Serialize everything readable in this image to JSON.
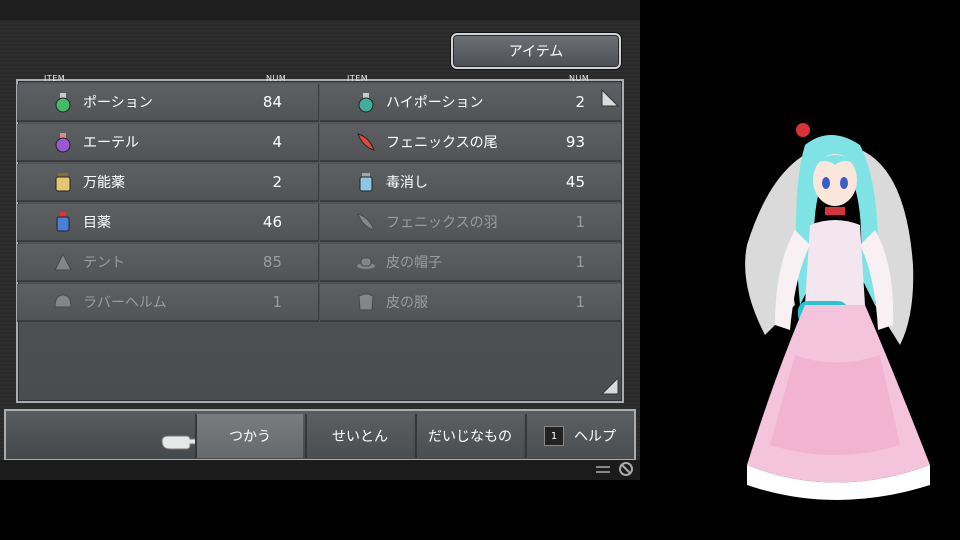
{
  "menu_title": "アイテム",
  "headers": {
    "item": "ITEM",
    "num": "NUM"
  },
  "items_left": [
    {
      "name": "ポーション",
      "num": "84",
      "icon": "potion-icon",
      "dim": false
    },
    {
      "name": "エーテル",
      "num": "4",
      "icon": "ether-icon",
      "dim": false
    },
    {
      "name": "万能薬",
      "num": "2",
      "icon": "elixir-jar-icon",
      "dim": false
    },
    {
      "name": "目薬",
      "num": "46",
      "icon": "eye-drops-icon",
      "dim": false
    },
    {
      "name": "テント",
      "num": "85",
      "icon": "tent-icon",
      "dim": true
    },
    {
      "name": "ラバーヘルム",
      "num": "1",
      "icon": "helm-icon",
      "dim": true
    }
  ],
  "items_right": [
    {
      "name": "ハイポーション",
      "num": "2",
      "icon": "hi-potion-icon",
      "dim": false
    },
    {
      "name": "フェニックスの尾",
      "num": "93",
      "icon": "phoenix-tail-icon",
      "dim": false
    },
    {
      "name": "毒消し",
      "num": "45",
      "icon": "antidote-icon",
      "dim": false
    },
    {
      "name": "フェニックスの羽",
      "num": "1",
      "icon": "feather-icon",
      "dim": true
    },
    {
      "name": "皮の帽子",
      "num": "1",
      "icon": "hat-icon",
      "dim": true
    },
    {
      "name": "皮の服",
      "num": "1",
      "icon": "armor-icon",
      "dim": true
    }
  ],
  "commands": {
    "use": "つかう",
    "sort": "せいとん",
    "key_items": "だいじなもの",
    "help_key": "1",
    "help": "ヘルプ"
  }
}
